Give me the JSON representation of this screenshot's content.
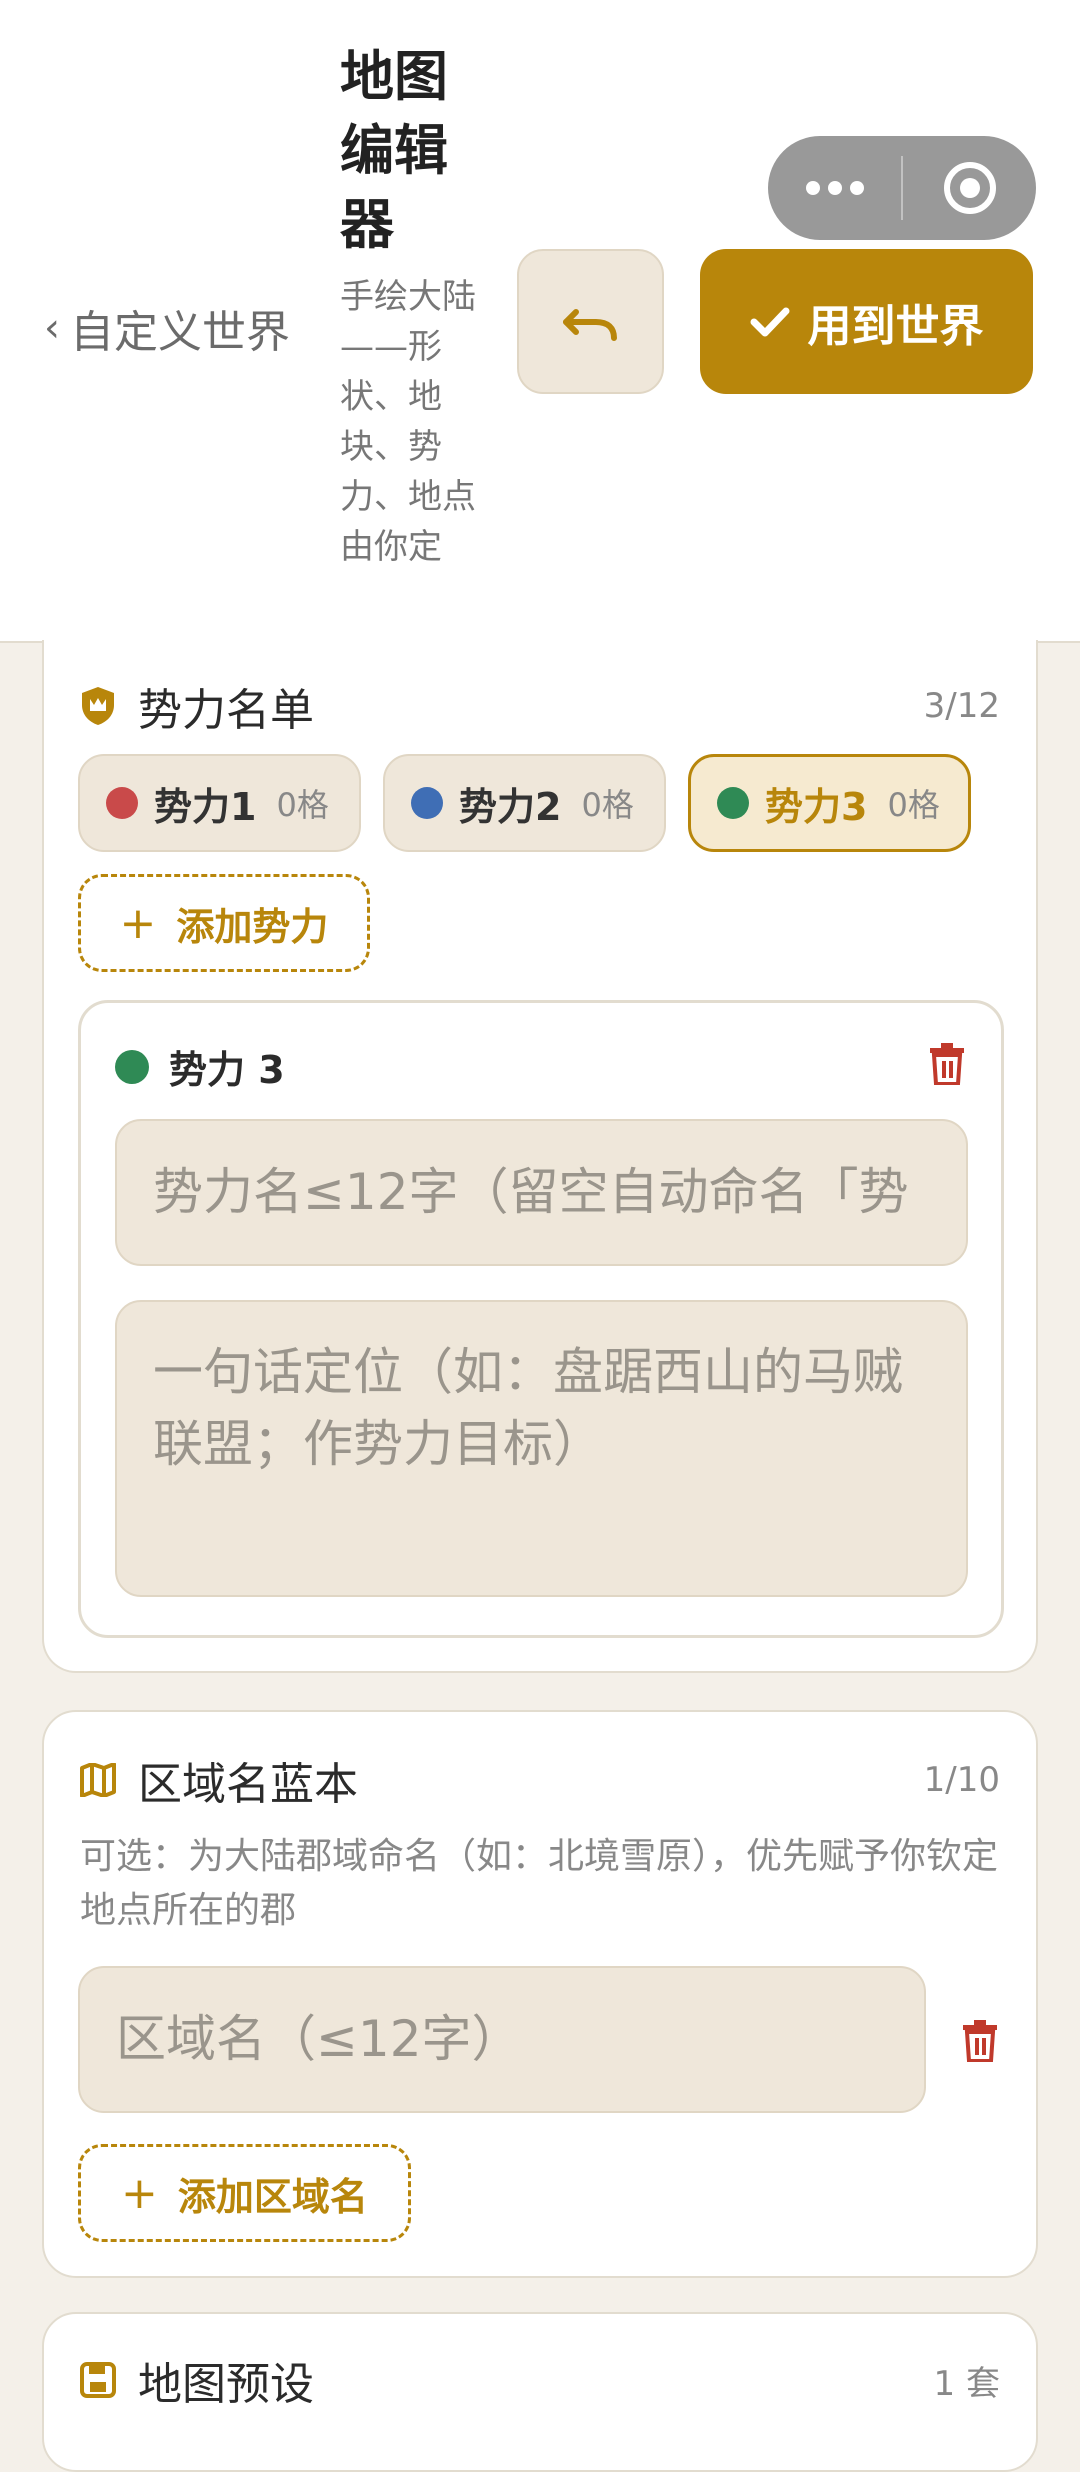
{
  "header": {
    "back_label": "自定义世界",
    "title": "地图编辑器",
    "subtitle": "手绘大陆——形状、地块、势力、地点由你定",
    "apply_label": "用到世界"
  },
  "factions_card": {
    "title": "势力名单",
    "count": "3/12",
    "chips": [
      {
        "name": "势力1",
        "cells": "0格",
        "color": "#c94a4a"
      },
      {
        "name": "势力2",
        "cells": "0格",
        "color": "#3f6eb5"
      },
      {
        "name": "势力3",
        "cells": "0格",
        "color": "#2f8a55"
      }
    ],
    "add_label": "添加势力",
    "editor": {
      "name": "势力 3",
      "name_placeholder": "势力名≤12字（留空自动命名「势",
      "desc_placeholder": "一句话定位（如：盘踞西山的马贼联盟；作势力目标）"
    }
  },
  "regions_card": {
    "title": "区域名蓝本",
    "count": "1/10",
    "hint": "可选：为大陆郡域命名（如：北境雪原），优先赋予你钦定地点所在的郡",
    "region_placeholder": "区域名（≤12字）",
    "add_label": "添加区域名"
  },
  "presets_card": {
    "title": "地图预设",
    "count": "1 套"
  },
  "colors": {
    "accent": "#b8860b",
    "danger": "#c0392b",
    "field_bg": "#efe7da",
    "page_bg": "#f4f0e9"
  }
}
